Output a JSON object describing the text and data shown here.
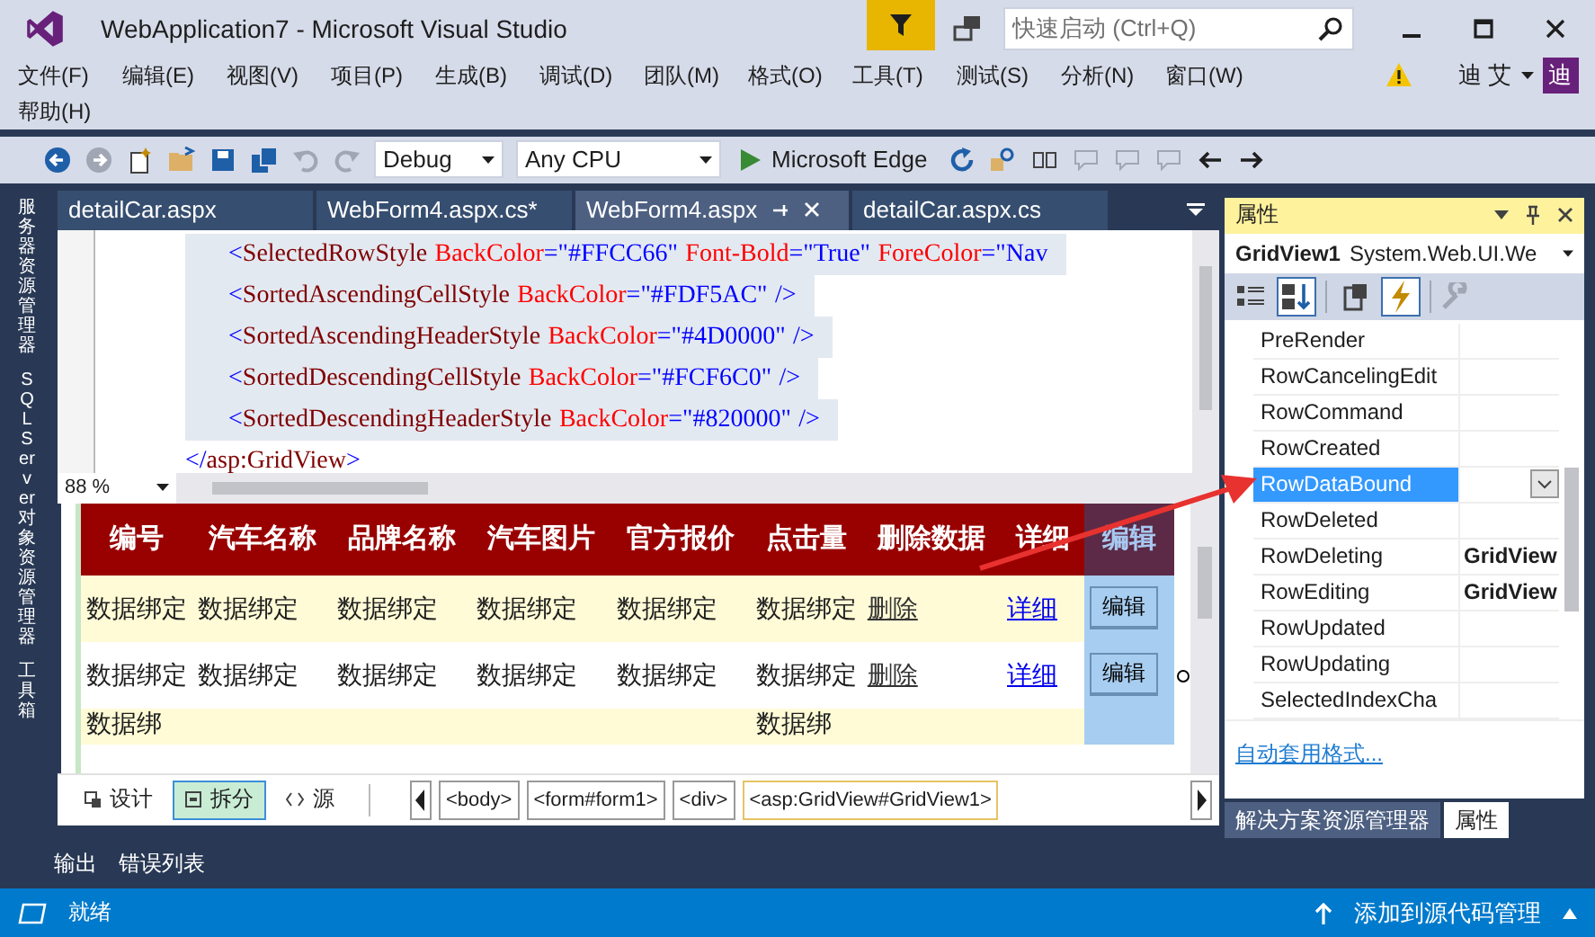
{
  "window": {
    "title": "WebApplication7 - Microsoft Visual Studio"
  },
  "quick_launch": {
    "placeholder": "快速启动 (Ctrl+Q)"
  },
  "menu_bar": {
    "items": [
      "文件(F)",
      "编辑(E)",
      "视图(V)",
      "项目(P)",
      "生成(B)",
      "调试(D)",
      "团队(M)",
      "格式(O)",
      "工具(T)",
      "测试(S)",
      "分析(N)",
      "窗口(W)",
      "帮助(H)"
    ],
    "user": "迪 艾",
    "avatar": "迪"
  },
  "toolbar": {
    "configuration": "Debug",
    "platform": "Any CPU",
    "run_target": "Microsoft Edge"
  },
  "side_tabs": [
    "服务器资源管理器",
    "SQL Server 对象资源管理器",
    "工具箱"
  ],
  "editor_tabs": [
    {
      "label": "detailCar.aspx",
      "selected": false
    },
    {
      "label": "WebForm4.aspx.cs*",
      "selected": false
    },
    {
      "label": "WebForm4.aspx",
      "selected": true
    },
    {
      "label": "detailCar.aspx.cs",
      "selected": false
    }
  ],
  "code_lines": [
    {
      "kind": "element",
      "tag": "<SelectedRowStyle",
      "attrs": [
        {
          "name": "BackColor",
          "value": "=\"#FFCC66\""
        },
        {
          "name": "Font-Bold",
          "value": "=\"True\""
        },
        {
          "name": "ForeColor",
          "value": "=\"Nav"
        }
      ],
      "selected": true
    },
    {
      "kind": "element",
      "tag": "<SortedAscendingCellStyle",
      "attrs": [
        {
          "name": "BackColor",
          "value": "=\"#FDF5AC\""
        }
      ],
      "end": "/>",
      "selected": true
    },
    {
      "kind": "element",
      "tag": "<SortedAscendingHeaderStyle",
      "attrs": [
        {
          "name": "BackColor",
          "value": "=\"#4D0000\""
        }
      ],
      "end": "/>",
      "selected": true
    },
    {
      "kind": "element",
      "tag": "<SortedDescendingCellStyle",
      "attrs": [
        {
          "name": "BackColor",
          "value": "=\"#FCF6C0\""
        }
      ],
      "end": "/>",
      "selected": true
    },
    {
      "kind": "element",
      "tag": "<SortedDescendingHeaderStyle",
      "attrs": [
        {
          "name": "BackColor",
          "value": "=\"#820000\""
        }
      ],
      "end": "/>",
      "selected": true
    },
    {
      "kind": "close",
      "tag": "</asp:GridView>",
      "selected": false
    }
  ],
  "zoom": "88 %",
  "grid": {
    "columns": [
      {
        "label": "编号",
        "selected": false
      },
      {
        "label": "汽车名称",
        "selected": false
      },
      {
        "label": "品牌名称",
        "selected": false
      },
      {
        "label": "汽车图片",
        "selected": false
      },
      {
        "label": "官方报价",
        "selected": false
      },
      {
        "label": "点击量",
        "selected": false
      },
      {
        "label": "删除数据",
        "selected": false
      },
      {
        "label": "详细",
        "selected": false
      },
      {
        "label": "编辑",
        "selected": true
      }
    ],
    "rows": [
      {
        "cells": [
          {
            "kind": "text",
            "text": "数据绑定"
          },
          {
            "kind": "text",
            "text": "数据绑定"
          },
          {
            "kind": "text",
            "text": "数据绑定"
          },
          {
            "kind": "text",
            "text": "数据绑定"
          },
          {
            "kind": "text",
            "text": "数据绑定"
          },
          {
            "kind": "text",
            "text": "数据绑定"
          },
          {
            "kind": "command",
            "text": "删除"
          },
          {
            "kind": "link",
            "text": "详细"
          },
          {
            "kind": "button",
            "text": "编辑"
          }
        ]
      },
      {
        "cells": [
          {
            "kind": "text",
            "text": "数据绑定"
          },
          {
            "kind": "text",
            "text": "数据绑定"
          },
          {
            "kind": "text",
            "text": "数据绑定"
          },
          {
            "kind": "text",
            "text": "数据绑定"
          },
          {
            "kind": "text",
            "text": "数据绑定"
          },
          {
            "kind": "text",
            "text": "数据绑定"
          },
          {
            "kind": "command",
            "text": "删除"
          },
          {
            "kind": "link",
            "text": "详细"
          },
          {
            "kind": "button",
            "text": "编辑"
          }
        ]
      },
      {
        "cells": [
          {
            "kind": "text",
            "text": "数据绑"
          },
          {
            "kind": "blank"
          },
          {
            "kind": "blank"
          },
          {
            "kind": "blank"
          },
          {
            "kind": "blank"
          },
          {
            "kind": "text",
            "text": "数据绑"
          },
          {
            "kind": "blank"
          },
          {
            "kind": "blank"
          },
          {
            "kind": "blank"
          }
        ]
      }
    ]
  },
  "view_buttons": [
    {
      "kind": "design",
      "label": "设计",
      "selected": false
    },
    {
      "kind": "split",
      "label": "拆分",
      "selected": true
    },
    {
      "kind": "source",
      "label": "源",
      "selected": false
    }
  ],
  "breadcrumb": [
    {
      "label": "<body>",
      "selected": false
    },
    {
      "label": "<form#form1>",
      "selected": false
    },
    {
      "label": "<div>",
      "selected": false
    },
    {
      "label": "<asp:GridView#GridView1>",
      "selected": true
    }
  ],
  "properties": {
    "title": "属性",
    "object": "GridView1",
    "type": "System.Web.UI.We",
    "view_modes": [
      {
        "kind": "categorized",
        "selected": false
      },
      {
        "kind": "alphabetical",
        "selected": true
      },
      {
        "kind": "properties",
        "selected": false
      },
      {
        "kind": "events",
        "selected": true
      }
    ],
    "rows": [
      {
        "name": "PreRender",
        "selected": false
      },
      {
        "name": "RowCancelingEdit",
        "selected": false
      },
      {
        "name": "RowCommand",
        "selected": false
      },
      {
        "name": "RowCreated",
        "selected": false
      },
      {
        "name": "RowDataBound",
        "selected": true
      },
      {
        "name": "RowDeleted",
        "selected": false
      },
      {
        "name": "RowDeleting",
        "value": "GridView",
        "selected": false
      },
      {
        "name": "RowEditing",
        "value": "GridView",
        "selected": false
      },
      {
        "name": "RowUpdated",
        "selected": false
      },
      {
        "name": "RowUpdating",
        "selected": false
      },
      {
        "name": "SelectedIndexCha",
        "selected": false
      }
    ],
    "link": "自动套用格式..."
  },
  "dock_tabs": [
    {
      "label": "解决方案资源管理器",
      "selected": false
    },
    {
      "label": "属性",
      "selected": true
    }
  ],
  "bottom_tabs": [
    "输出",
    "错误列表"
  ],
  "status": {
    "text": "就绪",
    "source_control": "添加到源代码管理"
  }
}
